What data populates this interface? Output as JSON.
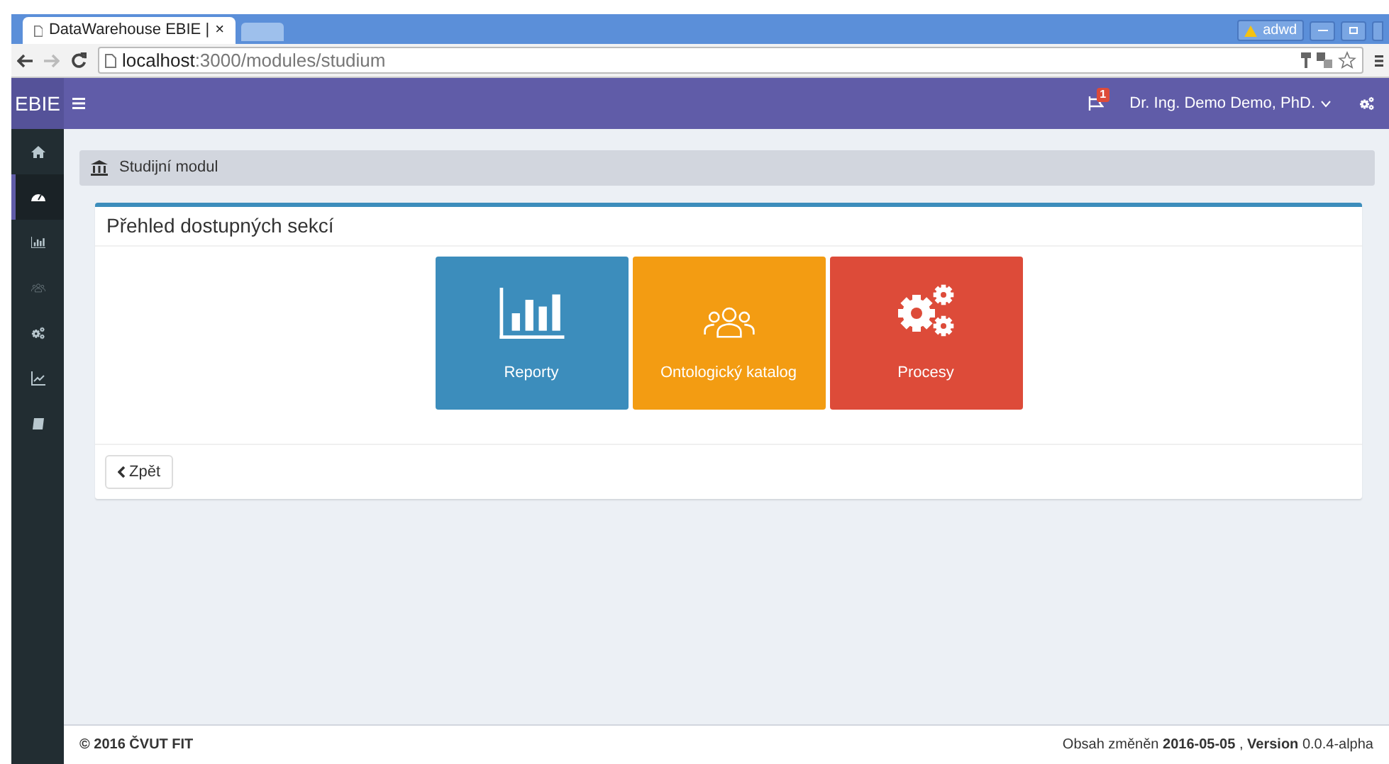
{
  "browser": {
    "tab_title": "DataWarehouse EBIE |",
    "tab_close": "×",
    "profile": "adwd",
    "url_host": "localhost",
    "url_path": ":3000/modules/studium"
  },
  "navbar": {
    "brand": "EBIE",
    "notification_count": "1",
    "user": "Dr. Ing. Demo Demo, PhD."
  },
  "sidebar": {
    "items": [
      {
        "kind": "home",
        "selected": false
      },
      {
        "kind": "dashboard",
        "selected": true
      },
      {
        "kind": "bars",
        "selected": false
      },
      {
        "kind": "users",
        "selected": false
      },
      {
        "kind": "gears",
        "selected": false
      },
      {
        "kind": "line",
        "selected": false
      },
      {
        "kind": "book",
        "selected": false
      }
    ]
  },
  "breadcrumb": "Studijní modul",
  "panel": {
    "title": "Přehled dostupných sekcí",
    "tiles": [
      {
        "label": "Reporty",
        "kind": "chart",
        "color": "#3c8dbc"
      },
      {
        "label": "Ontologický katalog",
        "kind": "users",
        "color": "#f39c12"
      },
      {
        "label": "Procesy",
        "kind": "gears",
        "color": "#dd4b39"
      }
    ],
    "back_button": "Zpět"
  },
  "footer": {
    "left": "© 2016 ČVUT FIT",
    "right": "Obsah změněn **2016-05-05** , **Version** 0.0.4-alpha"
  }
}
